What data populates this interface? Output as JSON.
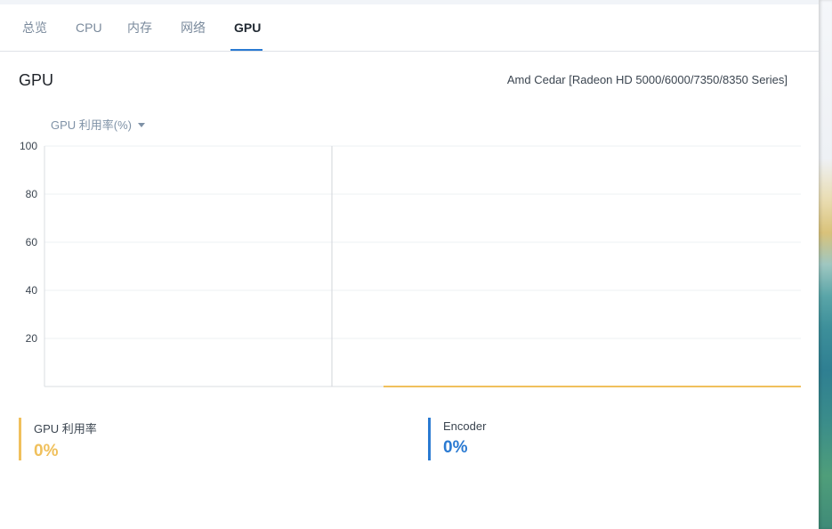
{
  "tabs": [
    {
      "label": "总览"
    },
    {
      "label": "CPU"
    },
    {
      "label": "内存"
    },
    {
      "label": "网络"
    },
    {
      "label": "GPU"
    }
  ],
  "active_tab": "GPU",
  "header": {
    "title": "GPU",
    "gpu_model": "Amd Cedar [Radeon HD 5000/6000/7350/8350 Series]"
  },
  "metric_select": {
    "selected": "GPU 利用率(%)"
  },
  "chart_data": {
    "type": "line",
    "yticks": [
      "100",
      "80",
      "60",
      "40",
      "20"
    ],
    "ylim": [
      0,
      100
    ],
    "grid": true,
    "series": [
      {
        "name": "GPU 利用率",
        "color": "#f0c05c",
        "values": [
          0,
          0
        ]
      }
    ]
  },
  "stats": {
    "gpu": {
      "label": "GPU 利用率",
      "value": "0%",
      "color": "#f0c05c"
    },
    "encoder": {
      "label": "Encoder",
      "value": "0%",
      "color": "#2a7ad2"
    }
  },
  "colors": {
    "accent": "#2a7ad2",
    "gpu_series": "#f0c05c"
  }
}
